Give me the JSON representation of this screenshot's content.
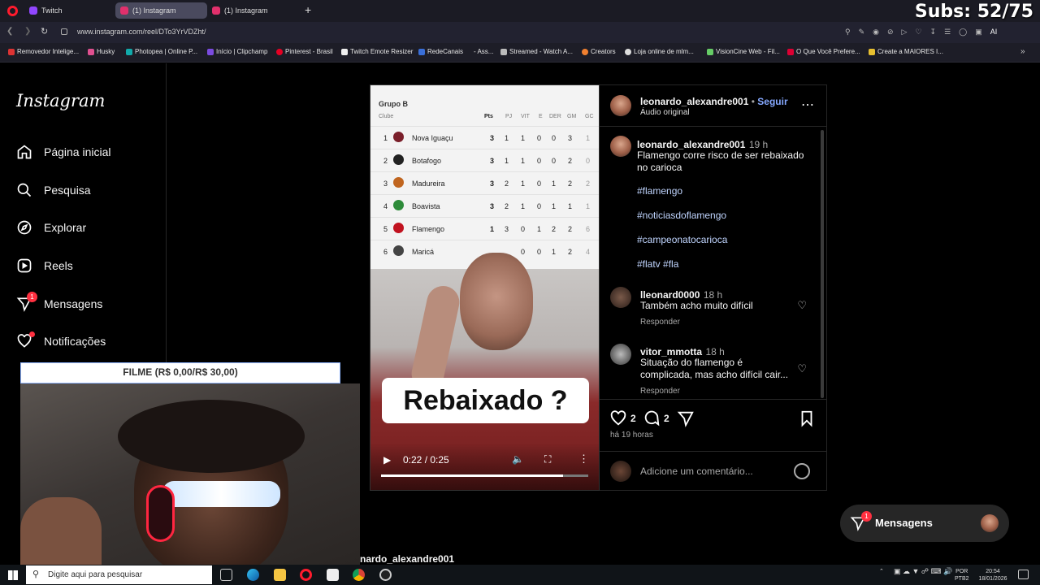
{
  "browser": {
    "tabs": [
      {
        "label": "Twitch",
        "color": "#9146ff"
      },
      {
        "label": "(1) Instagram",
        "color": "#e1306c"
      },
      {
        "label": "(1) Instagram",
        "color": "#e1306c"
      }
    ],
    "new_tab_label": "+",
    "url": "www.instagram.com/reel/DTo3YrVDZht/",
    "bookmarks": [
      "Removedor Intelige...",
      "Husky",
      "Photopea | Online P...",
      "Início | Clipchamp",
      "Pinterest - Brasil",
      "Twitch Emote Resizer",
      "RedeCanais",
      "- Ass...",
      "Streamed - Watch A...",
      "Creators",
      "Loja online de mlm...",
      "VisionCine Web - Fil...",
      "O Que Você Prefere...",
      "Create a MAIORES I..."
    ]
  },
  "overlay": {
    "subs": "Subs: 52/75",
    "filme": "FILME (R$ 0,00/R$ 30,00)"
  },
  "sidebar": {
    "logo": "Instagram",
    "items": [
      {
        "label": "Página inicial",
        "icon": "home-icon"
      },
      {
        "label": "Pesquisa",
        "icon": "search-icon"
      },
      {
        "label": "Explorar",
        "icon": "compass-icon"
      },
      {
        "label": "Reels",
        "icon": "reels-icon"
      },
      {
        "label": "Mensagens",
        "icon": "messages-icon",
        "badge": "1"
      },
      {
        "label": "Notificações",
        "icon": "heart-icon"
      }
    ]
  },
  "video": {
    "table": {
      "group": "Grupo B",
      "club_header": "Clube",
      "columns": [
        "Pts",
        "PJ",
        "VIT",
        "E",
        "DER",
        "GM",
        "GC"
      ],
      "rows": [
        {
          "pos": "1",
          "club": "Nova Iguaçu",
          "pts": "3",
          "pj": "1",
          "vit": "1",
          "e": "0",
          "der": "0",
          "gm": "3",
          "gc": "1",
          "color": "#7a1f2a"
        },
        {
          "pos": "2",
          "club": "Botafogo",
          "pts": "3",
          "pj": "1",
          "vit": "1",
          "e": "0",
          "der": "0",
          "gm": "2",
          "gc": "0",
          "color": "#222222"
        },
        {
          "pos": "3",
          "club": "Madureira",
          "pts": "3",
          "pj": "2",
          "vit": "1",
          "e": "0",
          "der": "1",
          "gm": "2",
          "gc": "2",
          "color": "#c0651f"
        },
        {
          "pos": "4",
          "club": "Boavista",
          "pts": "3",
          "pj": "2",
          "vit": "1",
          "e": "0",
          "der": "1",
          "gm": "1",
          "gc": "1",
          "color": "#2e8b3a"
        },
        {
          "pos": "5",
          "club": "Flamengo",
          "pts": "1",
          "pj": "3",
          "vit": "0",
          "e": "1",
          "der": "2",
          "gm": "2",
          "gc": "6",
          "color": "#c1121f"
        },
        {
          "pos": "6",
          "club": "Maricá",
          "pts": "",
          "pj": "",
          "vit": "0",
          "e": "0",
          "der": "1",
          "gm": "2",
          "gc": "4",
          "color": "#444444"
        }
      ]
    },
    "caption_overlay": "Rebaixado ?",
    "time": "0:22 / 0:25",
    "progress": 0.88
  },
  "post": {
    "author": "leonardo_alexandre001",
    "follow": "Seguir",
    "audio": "Áudio original",
    "caption_time": "19 h",
    "caption": "Flamengo corre risco de ser rebaixado no carioca",
    "hashtags": [
      "#flamengo",
      "#noticiasdoflamengo",
      "#campeonatocarioca",
      "#flatv #fla"
    ],
    "comments": [
      {
        "user": "lleonard0000",
        "time": "18 h",
        "text": "Também acho muito difícil",
        "reply": "Responder"
      },
      {
        "user": "vitor_mmotta",
        "time": "18 h",
        "text": "Situação do flamengo é complicada, mas acho difícil cair...",
        "reply": "Responder"
      }
    ],
    "likes": "2",
    "comments_count": "2",
    "posted": "há 19 horas",
    "comment_placeholder": "Adicione um comentário...",
    "next_author": "nardo_alexandre001"
  },
  "messages_pill": {
    "label": "Mensagens",
    "badge": "1"
  },
  "taskbar": {
    "search_placeholder": "Digite aqui para pesquisar",
    "lang1": "POR",
    "lang2": "PTB2",
    "time": "20:54",
    "date": "18/01/2026"
  }
}
